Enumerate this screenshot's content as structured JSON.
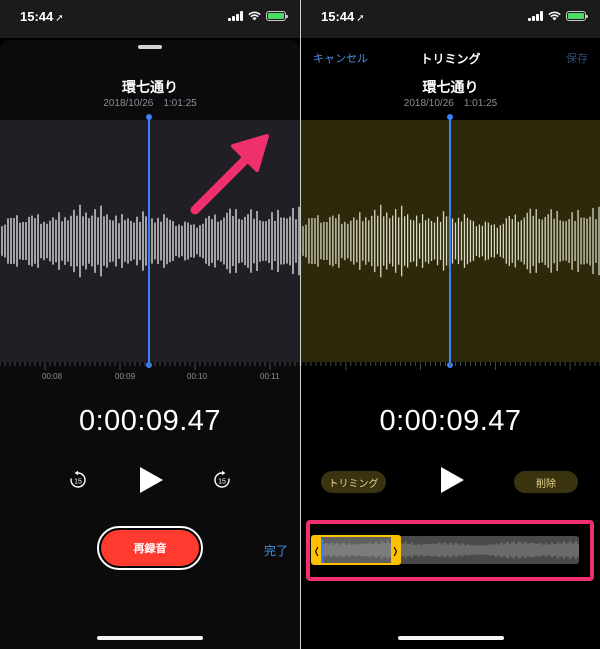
{
  "status": {
    "time": "15:44",
    "location_glyph": "⁴"
  },
  "recording": {
    "title": "環七通り",
    "date": "2018/10/26",
    "time_of_day": "1:01:25",
    "elapsed": "0:00:09.47"
  },
  "timeline": {
    "ticks": [
      "00:08",
      "00:09",
      "00:10",
      "00:11"
    ]
  },
  "left": {
    "rerecord_label": "再録音",
    "done_label": "完了",
    "skip_back_label": "15",
    "skip_forward_label": "15"
  },
  "right": {
    "cancel_label": "キャンセル",
    "nav_title": "トリミング",
    "save_label": "保存",
    "trim_button_label": "トリミング",
    "delete_button_label": "削除"
  },
  "colors": {
    "accent_blue": "#3a82f7",
    "record_red": "#ff3b30",
    "trim_yellow": "#ffc000",
    "annotation_pink": "#f0306c"
  },
  "icons": [
    "crop-icon",
    "play-icon",
    "skip-back-15-icon",
    "skip-forward-15-icon",
    "wifi-icon",
    "battery-icon",
    "signal-icon"
  ]
}
